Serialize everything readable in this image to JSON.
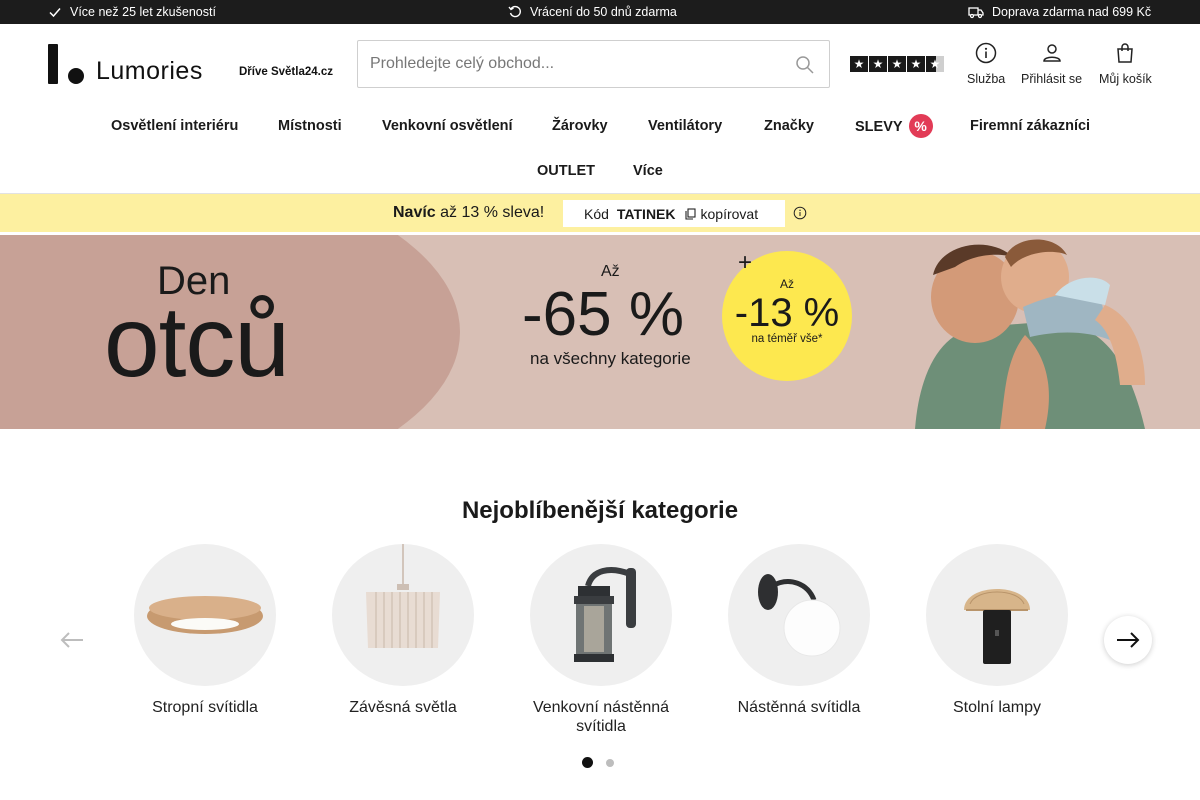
{
  "topbar": {
    "experience": "Více než 25 let zkušeností",
    "returns": "Vrácení do 50 dnů zdarma",
    "shipping": "Doprava zdarma nad 699 Kč"
  },
  "header": {
    "logo_text": "Lumories",
    "former_name": "Dříve Světla24.cz",
    "search_placeholder": "Prohledejte celý obchod...",
    "rating_stars": 4.5,
    "service_label": "Služba",
    "login_label": "Přihlásit se",
    "cart_label": "Můj košík"
  },
  "nav": {
    "items": [
      "Osvětlení interiéru",
      "Místnosti",
      "Venkovní osvětlení",
      "Žárovky",
      "Ventilátory",
      "Značky",
      "SLEVY",
      "Firemní zákazníci",
      "OUTLET",
      "Více"
    ],
    "sale_badge": "%"
  },
  "promo": {
    "lead": "Navíc",
    "text": "až 13 % sleva!",
    "code_label": "Kód",
    "code": "TATINEK",
    "copy_label": "kopírovat"
  },
  "hero": {
    "title_small": "Den",
    "title_big": "otců",
    "up_to": "Až",
    "discount": "-65 %",
    "discount_note": "na všechny kategorie",
    "plus": "+",
    "extra_up_to": "Až",
    "extra_discount": "-13 %",
    "extra_note": "na téměř vše*"
  },
  "categories": {
    "title": "Nejoblíbenější kategorie",
    "items": [
      {
        "label": "Stropní svítidla",
        "icon": "ceiling-light-icon"
      },
      {
        "label": "Závěsná světla",
        "icon": "pendant-light-icon"
      },
      {
        "label": "Venkovní nástěnná svítidla",
        "icon": "outdoor-wall-lantern-icon"
      },
      {
        "label": "Nástěnná svítidla",
        "icon": "wall-globe-light-icon"
      },
      {
        "label": "Stolní lampy",
        "icon": "table-lamp-icon"
      }
    ],
    "pages": 2,
    "current_page": 1
  },
  "colors": {
    "topbar_bg": "#1c1c1c",
    "promo_bg": "#fdf0a0",
    "hero_bg": "#d8bfb5",
    "hero_circle": "#fde84f",
    "sale_badge": "#e23b56"
  }
}
